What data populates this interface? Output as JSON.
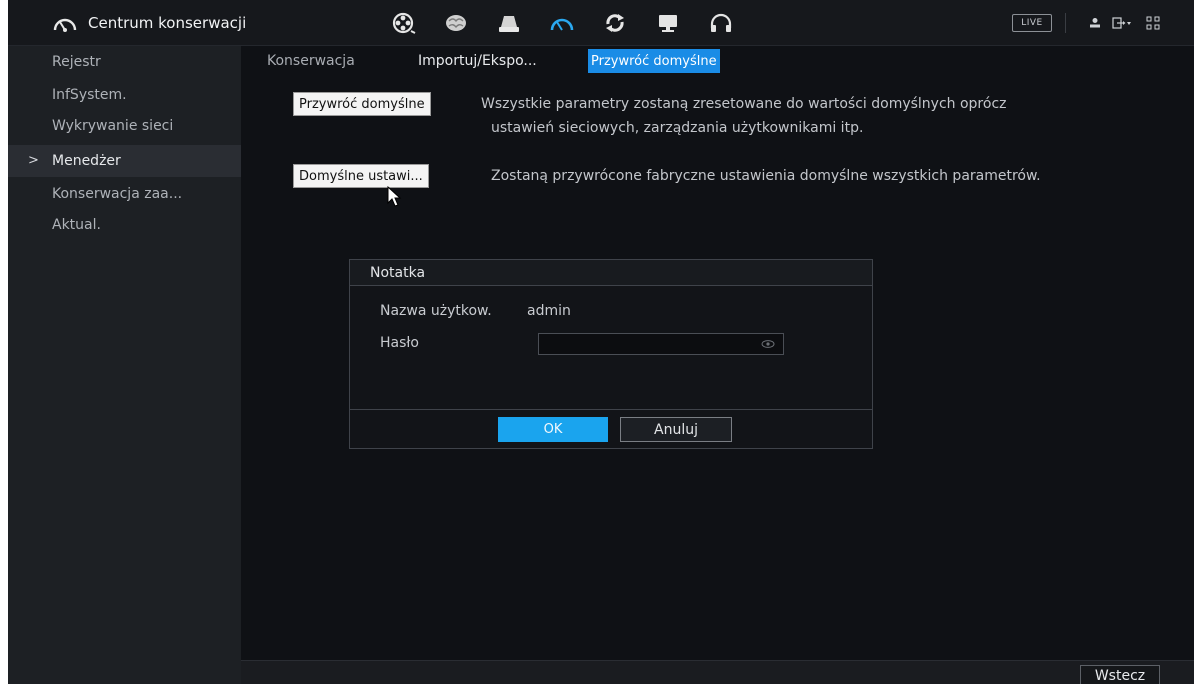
{
  "topbar": {
    "title": "Centrum konserwacji",
    "icons": [
      "film-reel-icon",
      "brain-icon",
      "storage-icon",
      "speedometer-icon",
      "sync-icon",
      "monitor-icon",
      "headset-icon"
    ],
    "live_label": "LIVE",
    "right_icons": [
      "user-icon",
      "logout-icon",
      "qr-grid-icon"
    ]
  },
  "sidebar": {
    "items": [
      {
        "label": "Rejestr"
      },
      {
        "label": "InfSystem."
      },
      {
        "label": "Wykrywanie sieci"
      },
      {
        "label": "Menedżer",
        "active": true,
        "marker": ">"
      },
      {
        "label": "Konserwacja zaa..."
      },
      {
        "label": "Aktual."
      }
    ]
  },
  "tabs": [
    {
      "label": "Konserwacja"
    },
    {
      "label": "Importuj/Ekspo..."
    },
    {
      "label": "Przywróć domyślne",
      "active": true
    }
  ],
  "options": [
    {
      "button": "Przywróć domyślne",
      "description_line1": "Wszystkie parametry zostaną zresetowane do wartości domyślnych oprócz",
      "description_line2": "ustawień sieciowych, zarządzania użytkownikami itp."
    },
    {
      "button": "Domyślne ustawi...",
      "description_line1": "Zostaną przywrócone fabryczne ustawienia domyślne wszystkich parametrów."
    }
  ],
  "dialog": {
    "title": "Notatka",
    "username_label": "Nazwa użytkow.",
    "username_value": "admin",
    "password_label": "Hasło",
    "password_value": "",
    "ok_label": "OK",
    "cancel_label": "Anuluj"
  },
  "footer": {
    "back_label": "Wstecz"
  },
  "colors": {
    "accent": "#1aa4ee",
    "tab_active": "#1a8ce6",
    "background": "#0f1115",
    "sidebar": "#1d2024"
  }
}
